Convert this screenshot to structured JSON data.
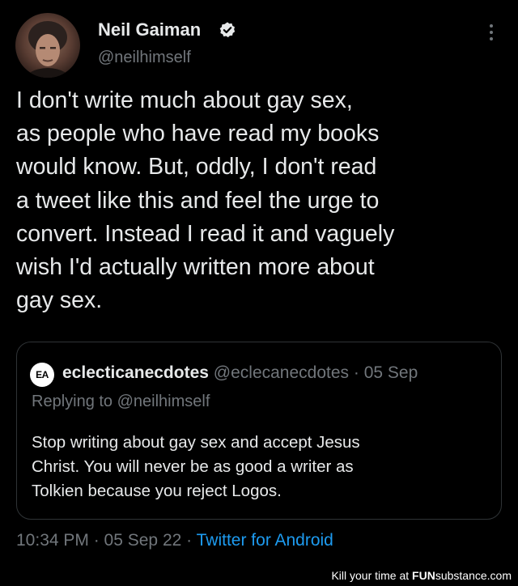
{
  "tweet": {
    "author_name": "Neil Gaiman",
    "verified": true,
    "handle": "@neilhimself",
    "text": "I don't write much about gay sex,\nas people who have read my books\nwould know. But, oddly, I don't read\na tweet like this and feel the urge to\nconvert. Instead I read it and vaguely\nwish I'd actually written more about\ngay sex.",
    "icons": {
      "avatar": "author-avatar",
      "verified": "verified-badge-icon",
      "more": "more-options-icon"
    }
  },
  "quoted_tweet": {
    "avatar_initials": "EA",
    "author_name": "eclecticanecdotes",
    "handle": "@eclecanecdotes",
    "separator": "·",
    "date": "05 Sep",
    "replying_prefix": "Replying to ",
    "replying_to": "@neilhimself",
    "text": "Stop writing about gay sex and accept Jesus\nChrist. You will never be as good a writer as\nTolkien because you reject Logos."
  },
  "meta": {
    "time_date": "10:34 PM · 05 Sep 22",
    "separator": "·",
    "source": "Twitter for Android"
  },
  "watermark": {
    "prefix": "Kill your time at ",
    "brand": "FUN",
    "brand_rest": "substance",
    "suffix": ".com"
  },
  "colors": {
    "background": "#000000",
    "text": "#e7e9ea",
    "secondary": "#71767b",
    "link": "#1d9bf0",
    "border": "#2f3336"
  }
}
